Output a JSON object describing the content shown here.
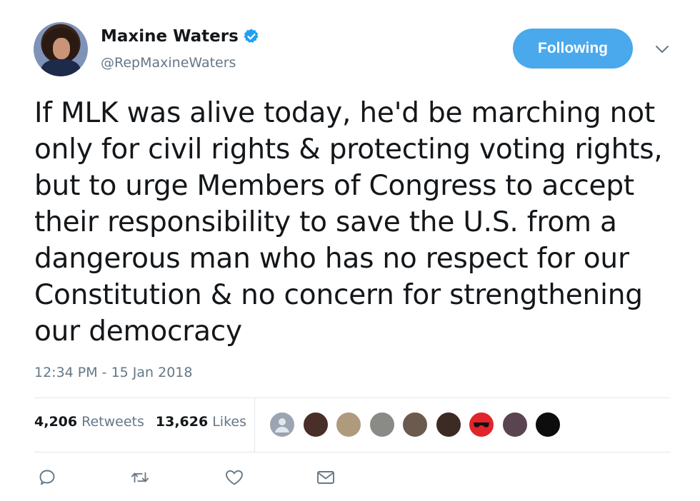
{
  "author": {
    "name": "Maxine Waters",
    "handle": "@RepMaxineWaters",
    "verified_icon": "verified-badge-icon"
  },
  "follow_button": {
    "label": "Following"
  },
  "menu": {
    "icon": "chevron-down-icon"
  },
  "tweet": {
    "lines": [
      "If MLK was alive today, he'd be marching not",
      "only for civil rights & protecting voting rights,",
      "but to urge Members of Congress to accept",
      "their responsibility to save the U.S. from a",
      "dangerous man who has no respect for our",
      "Constitution & no concern for strengthening",
      "our democracy"
    ],
    "timestamp": "12:34 PM - 15 Jan 2018"
  },
  "stats": {
    "retweets_count": "4,206",
    "retweets_label": "Retweets",
    "likes_count": "13,626",
    "likes_label": "Likes"
  },
  "likers": [
    {
      "color": "#9aa5b1",
      "icon": "default-avatar"
    },
    {
      "color": "#4a2e2a",
      "icon": "avatar"
    },
    {
      "color": "#b09a7e",
      "icon": "avatar"
    },
    {
      "color": "#8a8a86",
      "icon": "avatar"
    },
    {
      "color": "#6b5a4e",
      "icon": "avatar"
    },
    {
      "color": "#3b2b24",
      "icon": "avatar"
    },
    {
      "color": "#e2242b",
      "icon": "avatar"
    },
    {
      "color": "#5a4450",
      "icon": "avatar"
    },
    {
      "color": "#0d0d0d",
      "icon": "avatar"
    }
  ],
  "actions": [
    {
      "icon": "reply-icon"
    },
    {
      "icon": "retweet-icon"
    },
    {
      "icon": "like-icon"
    },
    {
      "icon": "direct-message-icon"
    }
  ],
  "colors": {
    "accent": "#4aa8ec",
    "text": "#14171a",
    "muted": "#657786",
    "divider": "#e1e8ed"
  }
}
